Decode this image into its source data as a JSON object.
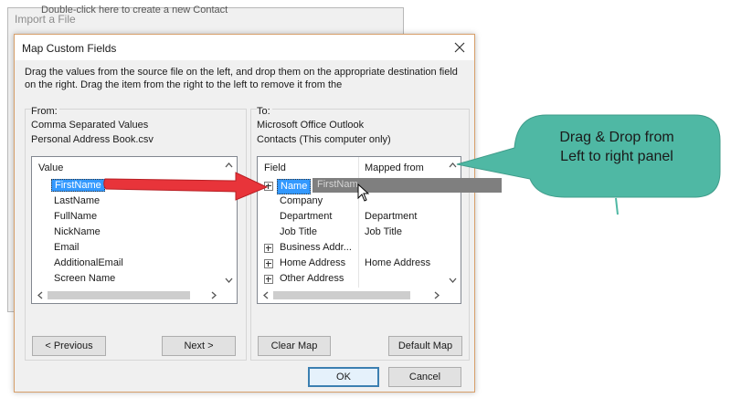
{
  "background_window": {
    "title": "Import a File",
    "hint": "Double-click here to create a new Contact"
  },
  "dialog": {
    "title": "Map Custom Fields",
    "instructions": "Drag the values from the source file on the left, and drop them on the appropriate destination field on the right.  Drag the item from the right to the left to remove it from the",
    "from": {
      "label": "From:",
      "source_line1": "Comma Separated Values",
      "source_line2": "Personal Address Book.csv",
      "column_header": "Value",
      "items": [
        "FirstName",
        "LastName",
        "FullName",
        "NickName",
        "Email",
        "AdditionalEmail",
        "Screen Name"
      ],
      "selected_index": 0
    },
    "to": {
      "label": "To:",
      "dest_line1": "Microsoft Office Outlook",
      "dest_line2": "Contacts (This computer only)",
      "col_field": "Field",
      "col_mapped": "Mapped from",
      "rows": [
        {
          "field": "Name",
          "mapped": "",
          "expandable": true,
          "selected": true
        },
        {
          "field": "Company",
          "mapped": "",
          "expandable": false,
          "selected": false
        },
        {
          "field": "Department",
          "mapped": "Department",
          "expandable": false,
          "selected": false
        },
        {
          "field": "Job Title",
          "mapped": "Job Title",
          "expandable": false,
          "selected": false
        },
        {
          "field": "Business Addr...",
          "mapped": "",
          "expandable": true,
          "selected": false
        },
        {
          "field": "Home Address",
          "mapped": "Home Address",
          "expandable": true,
          "selected": false
        },
        {
          "field": "Other Address",
          "mapped": "",
          "expandable": true,
          "selected": false
        }
      ]
    },
    "drag_ghost_text": "FirstNam",
    "buttons": {
      "previous": "< Previous",
      "next": "Next >",
      "clear_map": "Clear Map",
      "default_map": "Default Map",
      "ok": "OK",
      "cancel": "Cancel"
    }
  },
  "callout": {
    "line1": "Drag & Drop from",
    "line2": "Left to right panel",
    "color": "#4fb8a4"
  },
  "arrow_color": "#e8343a",
  "selection_color": "#3399ff"
}
